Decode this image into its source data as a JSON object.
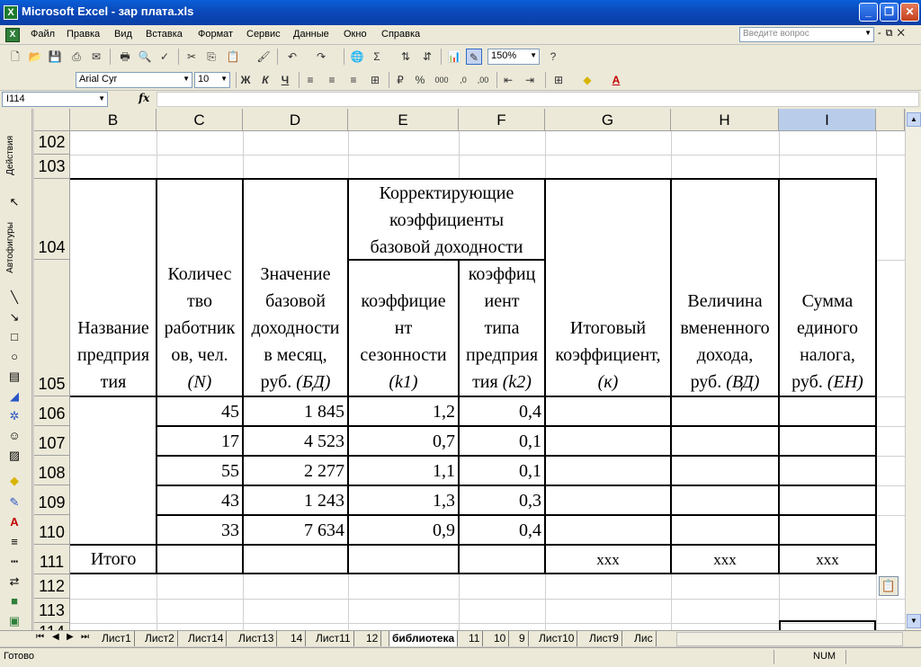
{
  "window": {
    "title": "Microsoft Excel - зар плата.xls"
  },
  "menu": [
    "Файл",
    "Правка",
    "Вид",
    "Вставка",
    "Формат",
    "Сервис",
    "Данные",
    "Окно",
    "Справка"
  ],
  "ask_placeholder": "Введите вопрос",
  "toolbar": {
    "zoom": "150%",
    "font": "Arial Cyr",
    "font_size": "10"
  },
  "formula": {
    "cell_ref": "I114",
    "fx": "fx",
    "content": ""
  },
  "drawing_toolbar": {
    "actions_label": "Действия",
    "autoshapes_label": "Автофигуры"
  },
  "columns": [
    "B",
    "C",
    "D",
    "E",
    "F",
    "G",
    "H",
    "I"
  ],
  "rows": [
    "102",
    "103",
    "104",
    "105",
    "106",
    "107",
    "108",
    "109",
    "110",
    "111",
    "112",
    "113",
    "114"
  ],
  "table": {
    "group_header": [
      "Корректирующие",
      "коэффициенты",
      "базовой доходности"
    ],
    "headers": {
      "name": [
        "Название",
        "предприя",
        "тия"
      ],
      "workers": [
        "Количес",
        "тво",
        "работник",
        "ов, чел."
      ],
      "workers_sym": "(N)",
      "base": [
        "Значение",
        "базовой",
        "доходности",
        "в месяц,"
      ],
      "base_unit": "руб.",
      "base_sym": "(БД)",
      "k1": [
        "коэффицие",
        "нт",
        "сезонности"
      ],
      "k1_sym": "(k1)",
      "k2": [
        "коэффиц",
        "иент",
        "типа",
        "предприя"
      ],
      "k2_pre": "тия",
      "k2_sym": "(k2)",
      "total_k": [
        "Итоговый",
        "коэффициент,"
      ],
      "total_k_sym": "(к)",
      "imputed": [
        "Величина",
        "вмененного",
        "дохода,"
      ],
      "imputed_unit": "руб.",
      "imputed_sym": "(ВД)",
      "tax": [
        "Сумма",
        "единого",
        "налога,"
      ],
      "tax_unit": "руб.",
      "tax_sym": "(ЕН)"
    },
    "data": [
      {
        "row": "106",
        "N": "45",
        "BD": "1 845",
        "k1": "1,2",
        "k2": "0,4"
      },
      {
        "row": "107",
        "N": "17",
        "BD": "4 523",
        "k1": "0,7",
        "k2": "0,1"
      },
      {
        "row": "108",
        "N": "55",
        "BD": "2 277",
        "k1": "1,1",
        "k2": "0,1"
      },
      {
        "row": "109",
        "N": "43",
        "BD": "1 243",
        "k1": "1,3",
        "k2": "0,3"
      },
      {
        "row": "110",
        "N": "33",
        "BD": "7 634",
        "k1": "0,9",
        "k2": "0,4"
      }
    ],
    "total_row": {
      "label": "Итого",
      "g": "ххх",
      "h": "ххх",
      "i": "ххх"
    }
  },
  "sheet_tabs": [
    "Лист1",
    "Лист2",
    "Лист14",
    "Лист13",
    "14",
    "Лист11",
    "12",
    "библиотека",
    "11",
    "10",
    "9",
    "Лист10",
    "Лист9",
    "Лис"
  ],
  "active_tab": "библиотека",
  "status": {
    "text": "Готово",
    "num": "NUM"
  }
}
